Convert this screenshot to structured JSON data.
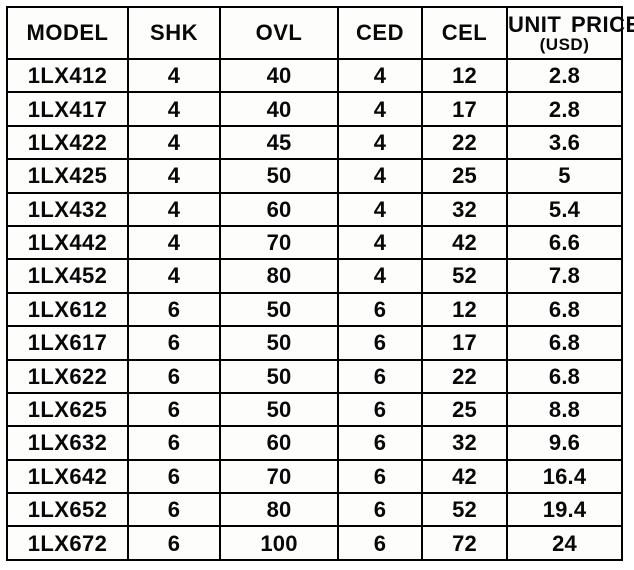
{
  "table": {
    "columns": [
      {
        "key": "model",
        "label": "MODEL"
      },
      {
        "key": "shk",
        "label": "SHK"
      },
      {
        "key": "ovl",
        "label": "OVL"
      },
      {
        "key": "ced",
        "label": "CED"
      },
      {
        "key": "cel",
        "label": "CEL"
      },
      {
        "key": "price",
        "label_line1": "UNIT PRICE",
        "label_line2": "(USD)"
      }
    ],
    "rows": [
      {
        "model": "1LX412",
        "shk": "4",
        "ovl": "40",
        "ced": "4",
        "cel": "12",
        "price": "2.8"
      },
      {
        "model": "1LX417",
        "shk": "4",
        "ovl": "40",
        "ced": "4",
        "cel": "17",
        "price": "2.8"
      },
      {
        "model": "1LX422",
        "shk": "4",
        "ovl": "45",
        "ced": "4",
        "cel": "22",
        "price": "3.6"
      },
      {
        "model": "1LX425",
        "shk": "4",
        "ovl": "50",
        "ced": "4",
        "cel": "25",
        "price": "5"
      },
      {
        "model": "1LX432",
        "shk": "4",
        "ovl": "60",
        "ced": "4",
        "cel": "32",
        "price": "5.4"
      },
      {
        "model": "1LX442",
        "shk": "4",
        "ovl": "70",
        "ced": "4",
        "cel": "42",
        "price": "6.6"
      },
      {
        "model": "1LX452",
        "shk": "4",
        "ovl": "80",
        "ced": "4",
        "cel": "52",
        "price": "7.8"
      },
      {
        "model": "1LX612",
        "shk": "6",
        "ovl": "50",
        "ced": "6",
        "cel": "12",
        "price": "6.8"
      },
      {
        "model": "1LX617",
        "shk": "6",
        "ovl": "50",
        "ced": "6",
        "cel": "17",
        "price": "6.8"
      },
      {
        "model": "1LX622",
        "shk": "6",
        "ovl": "50",
        "ced": "6",
        "cel": "22",
        "price": "6.8"
      },
      {
        "model": "1LX625",
        "shk": "6",
        "ovl": "50",
        "ced": "6",
        "cel": "25",
        "price": "8.8"
      },
      {
        "model": "1LX632",
        "shk": "6",
        "ovl": "60",
        "ced": "6",
        "cel": "32",
        "price": "9.6"
      },
      {
        "model": "1LX642",
        "shk": "6",
        "ovl": "70",
        "ced": "6",
        "cel": "42",
        "price": "16.4"
      },
      {
        "model": "1LX652",
        "shk": "6",
        "ovl": "80",
        "ced": "6",
        "cel": "52",
        "price": "19.4"
      },
      {
        "model": "1LX672",
        "shk": "6",
        "ovl": "100",
        "ced": "6",
        "cel": "72",
        "price": "24"
      }
    ]
  },
  "chart_data": {
    "type": "table",
    "title": "",
    "columns": [
      "MODEL",
      "SHK",
      "OVL",
      "CED",
      "CEL",
      "UNIT PRICE (USD)"
    ],
    "rows": [
      [
        "1LX412",
        4,
        40,
        4,
        12,
        2.8
      ],
      [
        "1LX417",
        4,
        40,
        4,
        17,
        2.8
      ],
      [
        "1LX422",
        4,
        45,
        4,
        22,
        3.6
      ],
      [
        "1LX425",
        4,
        50,
        4,
        25,
        5
      ],
      [
        "1LX432",
        4,
        60,
        4,
        32,
        5.4
      ],
      [
        "1LX442",
        4,
        70,
        4,
        42,
        6.6
      ],
      [
        "1LX452",
        4,
        80,
        4,
        52,
        7.8
      ],
      [
        "1LX612",
        6,
        50,
        6,
        12,
        6.8
      ],
      [
        "1LX617",
        6,
        50,
        6,
        17,
        6.8
      ],
      [
        "1LX622",
        6,
        50,
        6,
        22,
        6.8
      ],
      [
        "1LX625",
        6,
        50,
        6,
        25,
        8.8
      ],
      [
        "1LX632",
        6,
        60,
        6,
        32,
        9.6
      ],
      [
        "1LX642",
        6,
        70,
        6,
        42,
        16.4
      ],
      [
        "1LX652",
        6,
        80,
        6,
        52,
        19.4
      ],
      [
        "1LX672",
        6,
        100,
        6,
        72,
        24
      ]
    ]
  },
  "colors": {
    "border": "#000000",
    "text": "#08080a",
    "cell_background": "#fdfdfb",
    "page_background": "#ffffff"
  }
}
